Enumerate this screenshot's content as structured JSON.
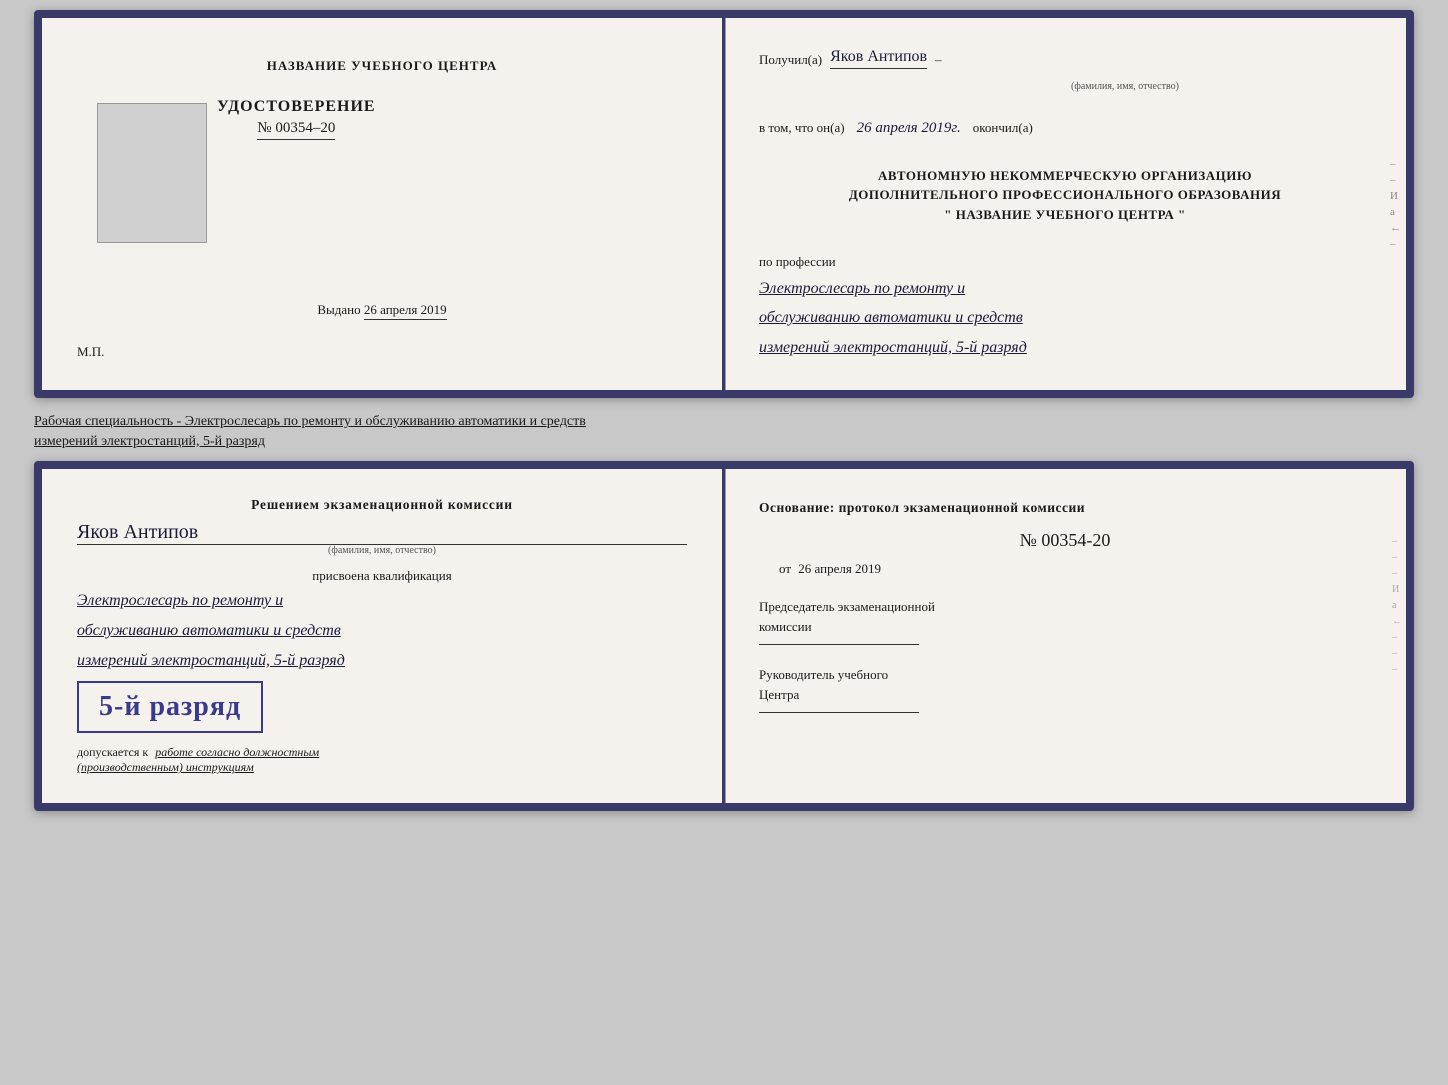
{
  "doc1": {
    "left": {
      "center_title": "НАЗВАНИЕ УЧЕБНОГО ЦЕНТРА",
      "cert_title": "УДОСТОВЕРЕНИЕ",
      "cert_number": "№ 00354–20",
      "date_label": "Выдано",
      "date_value": "26 апреля 2019",
      "mp_label": "М.П."
    },
    "right": {
      "received_label": "Получил(а)",
      "recipient_name": "Яков Антипов",
      "name_subtext": "(фамилия, имя, отчество)",
      "dash": "–",
      "in_that_label": "в том, что он(а)",
      "date_handwritten": "26 апреля 2019г.",
      "finished_label": "окончил(а)",
      "org_line1": "АВТОНОМНУЮ НЕКОММЕРЧЕСКУЮ ОРГАНИЗАЦИЮ",
      "org_line2": "ДОПОЛНИТЕЛЬНОГО ПРОФЕССИОНАЛЬНОГО ОБРАЗОВАНИЯ",
      "org_line3": "\" НАЗВАНИЕ УЧЕБНОГО ЦЕНТРА \"",
      "profession_label": "по профессии",
      "profession_line1": "Электрослесарь по ремонту и",
      "profession_line2": "обслуживанию автоматики и средств",
      "profession_line3": "измерений электростанций, 5-й разряд"
    }
  },
  "separator_text": "Рабочая специальность - Электрослесарь по ремонту и обслуживанию автоматики и средств\nизмерений электростанций, 5-й разряд",
  "doc2": {
    "left": {
      "decision_text": "Решением экзаменационной комиссии",
      "person_name": "Яков Антипов",
      "name_subtext": "(фамилия, имя, отчество)",
      "qualification_label": "присвоена квалификация",
      "qual_line1": "Электрослесарь по ремонту и",
      "qual_line2": "обслуживанию автоматики и средств",
      "qual_line3": "измерений электростанций, 5-й разряд",
      "grade_text": "5-й разряд",
      "admission_text": "допускается к",
      "admission_italic": "работе согласно должностным\n(производственным) инструкциям"
    },
    "right": {
      "basis_label": "Основание: протокол экзаменационной комиссии",
      "protocol_number": "№ 00354-20",
      "from_prefix": "от",
      "from_date": "26 апреля 2019",
      "chairman_label1": "Председатель экзаменационной",
      "chairman_label2": "комиссии",
      "head_label1": "Руководитель учебного",
      "head_label2": "Центра"
    }
  }
}
